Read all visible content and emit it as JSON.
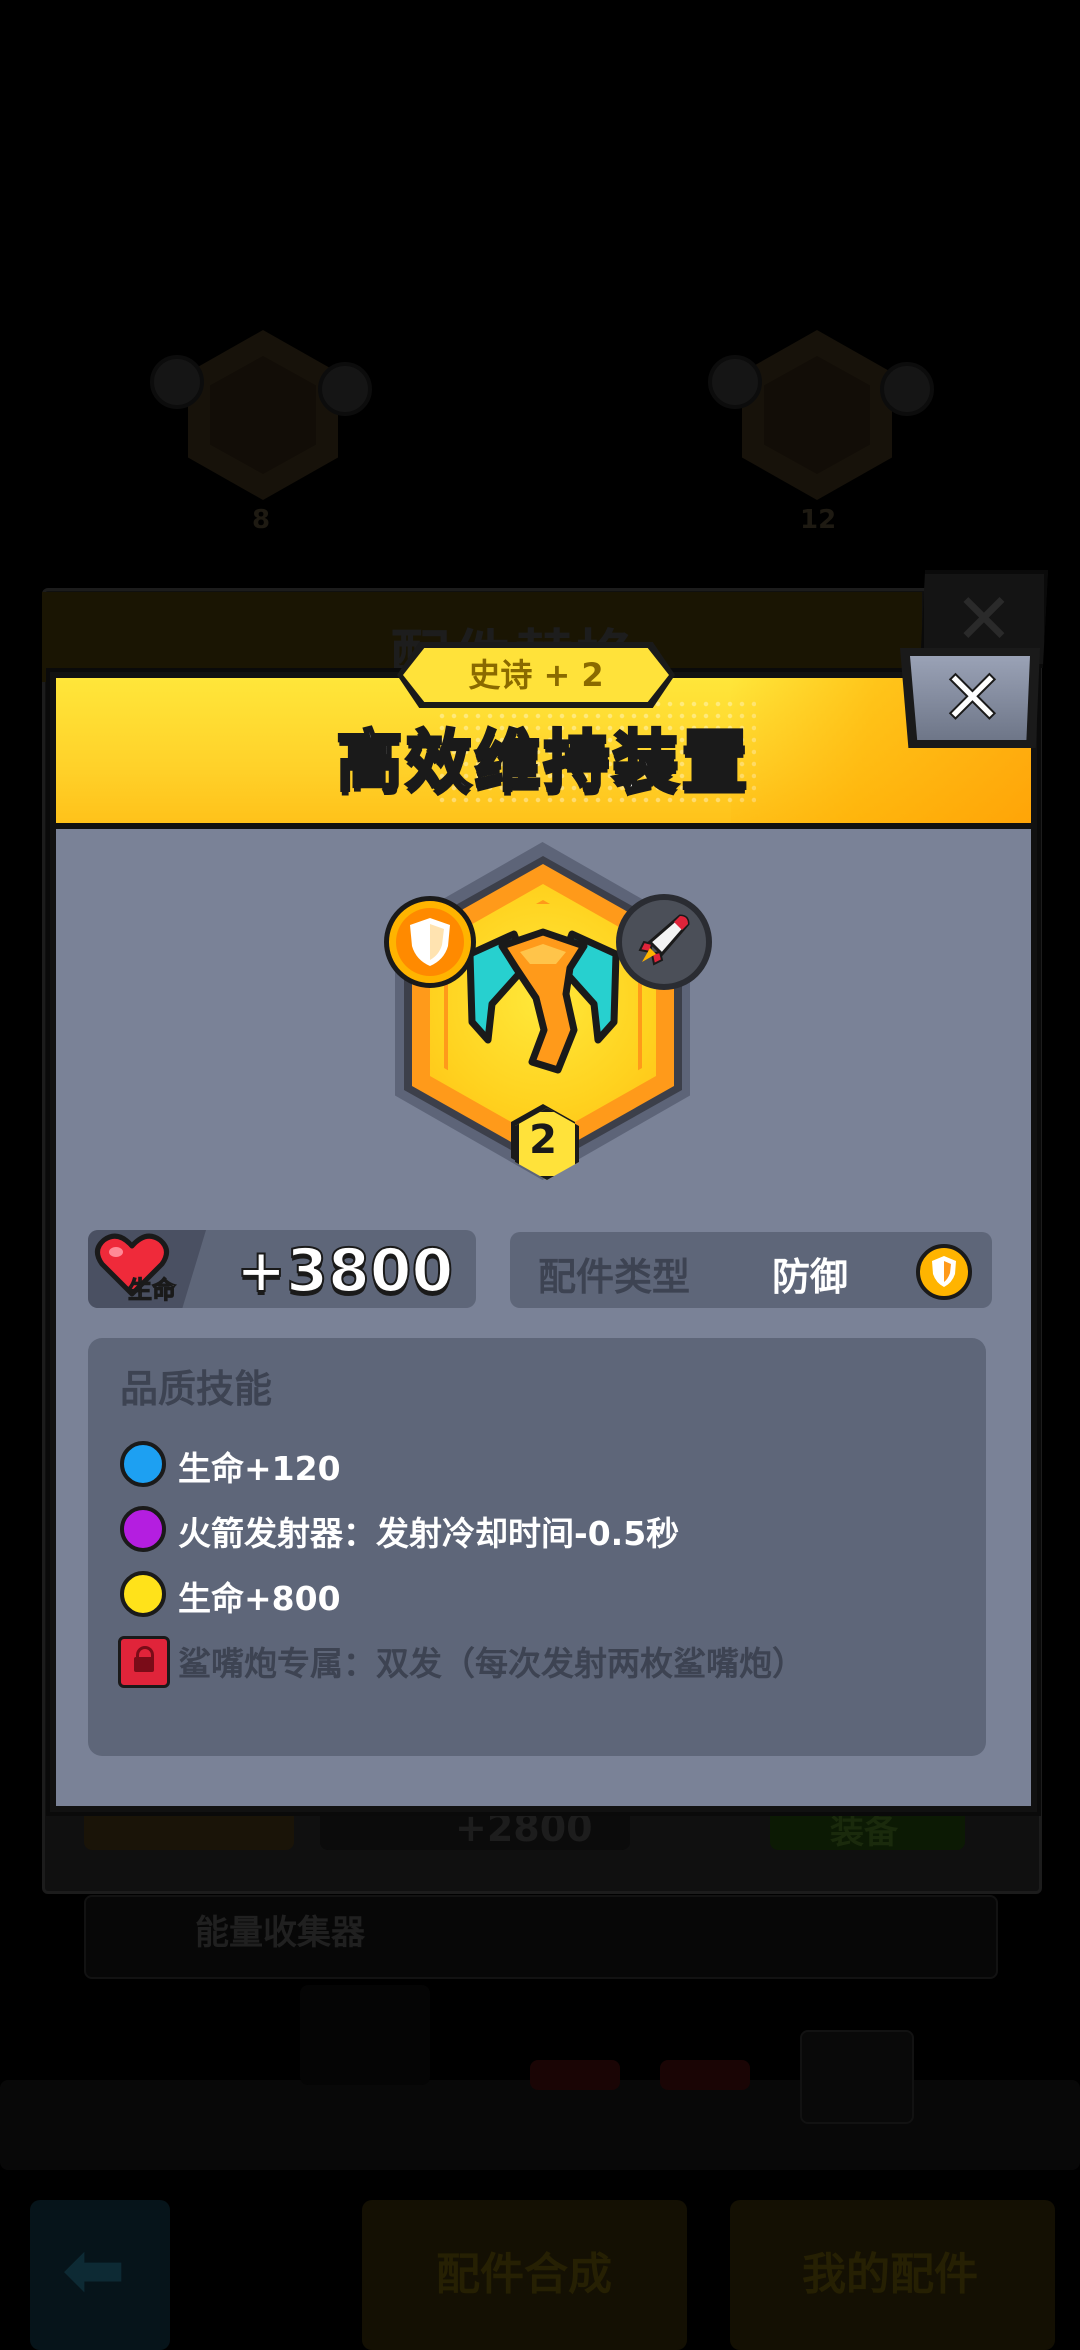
{
  "background": {
    "panel_title": "配件替换",
    "slot_left_level": "8",
    "slot_right_level": "12",
    "row_value": "+2800",
    "equip_button": "装备",
    "energy_label": "能量收集器",
    "bottom_buttons": [
      "配件合成",
      "我的配件"
    ]
  },
  "popup": {
    "rarity": "史诗 + 2",
    "title": "高效维持装置",
    "close_icon": "close-icon",
    "item": {
      "level": "2",
      "icon": "armor-part-icon",
      "type_badge_icon": "shield-icon",
      "weapon_badge_icon": "rocket-icon"
    },
    "hp": {
      "icon": "heart-icon",
      "label": "生命",
      "value": "+3800"
    },
    "type": {
      "label": "配件类型",
      "value": "防御",
      "icon": "shield-icon"
    },
    "skills": {
      "title": "品质技能",
      "items": [
        {
          "color": "#1da0f2",
          "text": "生命+120",
          "locked": false
        },
        {
          "color": "#b41ee0",
          "text": "火箭发射器：发射冷却时间-0.5秒",
          "locked": false
        },
        {
          "color": "#ffe21a",
          "text": "生命+800",
          "locked": false
        },
        {
          "color": "#e0243a",
          "text": "鲨嘴炮专属：双发（每次发射两枚鲨嘴炮）",
          "locked": true
        }
      ]
    }
  }
}
